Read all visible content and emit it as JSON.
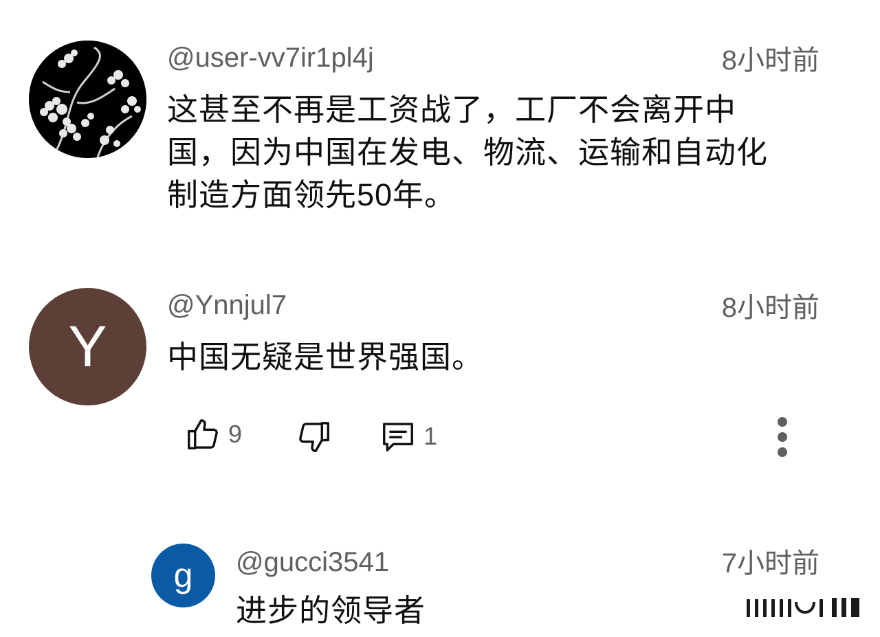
{
  "comments": [
    {
      "handle": "@user-vv7ir1pl4j",
      "time": "8小时前",
      "text_lines": [
        "这甚至不再是工资战了，工厂不会离开中",
        "国，因为中国在发电、物流、运输和自动化",
        "制造方面领先50年。"
      ],
      "avatar": "blossom-image"
    },
    {
      "handle": "@Ynnjul7",
      "time": "8小时前",
      "text": "中国无疑是世界强国。",
      "avatar_letter": "Y",
      "avatar_color": "#5c4037",
      "actions": {
        "like_count": "9",
        "reply_count": "1"
      }
    },
    {
      "handle": "@gucci3541",
      "time": "7小时前",
      "text": "进步的领导者",
      "avatar_letter": "g",
      "avatar_color": "#0a5aa6"
    }
  ],
  "icons": [
    "thumbs-up-icon",
    "thumbs-down-icon",
    "comment-icon",
    "more-vertical-icon"
  ]
}
